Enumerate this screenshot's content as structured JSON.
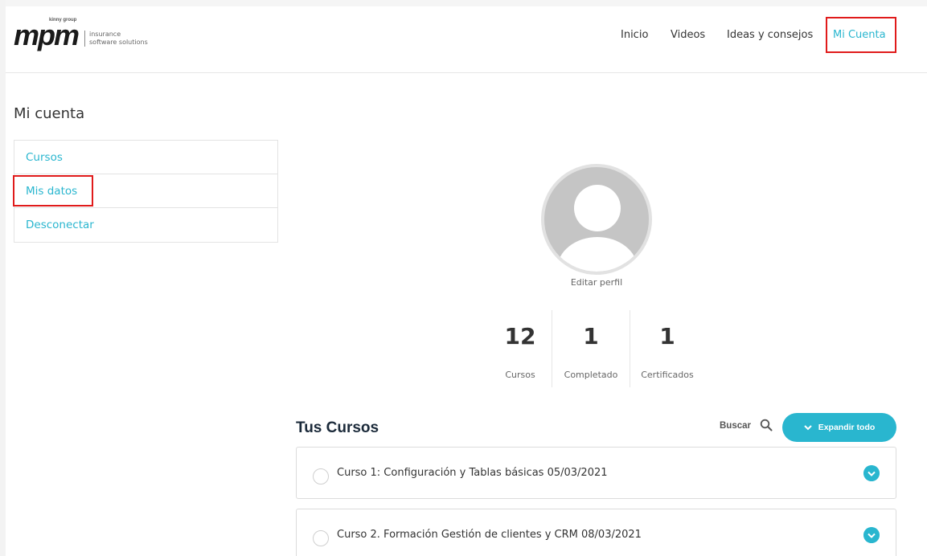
{
  "header": {
    "logo": {
      "brand": "mpm",
      "tagline": "kinny group",
      "subtitle_line1": "insurance",
      "subtitle_line2": "software solutions"
    },
    "nav": [
      {
        "label": "Inicio",
        "active": false
      },
      {
        "label": "Videos",
        "active": false
      },
      {
        "label": "Ideas y consejos",
        "active": false
      },
      {
        "label": "Mi Cuenta",
        "active": true
      }
    ]
  },
  "sidebar": {
    "title": "Mi cuenta",
    "items": [
      {
        "label": "Cursos"
      },
      {
        "label": "Mis datos"
      },
      {
        "label": "Desconectar"
      }
    ]
  },
  "profile": {
    "avatar_icon": "default-user-avatar",
    "edit_label": "Editar perfil",
    "stats": [
      {
        "value": "12",
        "label": "Cursos"
      },
      {
        "value": "1",
        "label": "Completado"
      },
      {
        "value": "1",
        "label": "Certificados"
      }
    ]
  },
  "courses": {
    "title": "Tus Cursos",
    "search_label": "Buscar",
    "expand_label": "Expandir todo",
    "items": [
      {
        "title": "Curso 1: Configuración y Tablas básicas 05/03/2021"
      },
      {
        "title": "Curso 2. Formación Gestión de clientes y CRM 08/03/2021"
      }
    ]
  },
  "colors": {
    "accent": "#29b6cf",
    "highlight_box": "#e01b1b"
  }
}
